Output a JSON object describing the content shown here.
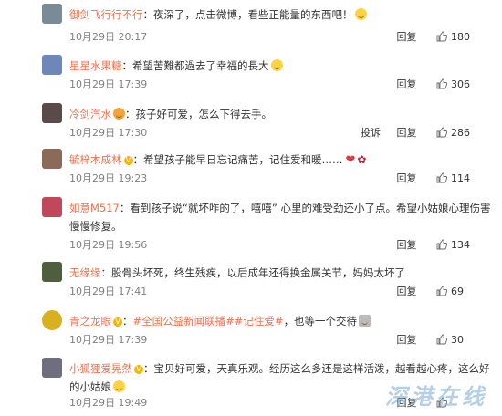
{
  "comments": [
    {
      "user": "御剑飞行行不行",
      "sep": "：",
      "text": "夜深了，点击微博，看些正能量的东西吧！",
      "date": "10月29日 20:17",
      "reply": "回复",
      "likes": "180",
      "avatar_color": "#7a8a96"
    },
    {
      "user": "星星水果糖",
      "sep": "：",
      "text": "希望苦難都過去了幸福的長大",
      "date": "10月29日 17:39",
      "reply": "回复",
      "likes": "306",
      "avatar_color": "#6f86b8"
    },
    {
      "user": "冷剑汽水",
      "sep": "：",
      "text": "孩子好可爱，怎么下得去手。",
      "date": "10月29日 17:30",
      "report": "投诉",
      "reply": "回复",
      "likes": "286",
      "avatar_color": "#5a4a4a"
    },
    {
      "user": "毓梓木成林",
      "sep": "：",
      "text": "希望孩子能早日忘记痛苦，记住爱和暖……",
      "date": "10月29日 19:23",
      "reply": "回复",
      "likes": "114",
      "avatar_color": "#8c6a5a"
    },
    {
      "user": "如意M517",
      "sep": "：",
      "text": "看到孩子说“就坏咋的了，嘻嘻” 心里的难受劲还小了点。希望小姑娘心理伤害慢慢修复。",
      "date": "10月29日 19:56",
      "reply": "回复",
      "likes": "134",
      "avatar_color": "#c0485a"
    },
    {
      "user": "无缘缘",
      "sep": "：",
      "text": "股骨头坏死，终生残疾，以后成年还得换金属关节，妈妈太坏了",
      "date": "10月29日 17:41",
      "reply": "回复",
      "likes": "69",
      "avatar_color": "#4e5e3e"
    },
    {
      "user": "青之龙眼",
      "sep": "：",
      "topic": "#全国公益新闻联播#",
      "topic2": "#记住爱#",
      "text": "，也等一个交待",
      "date": "10月29日 17:39",
      "reply": "回复",
      "likes": "30",
      "avatar_color": "#d8b020"
    },
    {
      "user": "小狐狸爱晃然",
      "sep": "：",
      "text": "宝贝好可爱，天真乐观。经历这么多还是这样活泼，越看越心疼，这么好的小姑娘",
      "date": "10月29日 19:49",
      "reply": "回复",
      "likes": "",
      "avatar_color": "#6e6e7e"
    }
  ],
  "watermark": "深港在线"
}
